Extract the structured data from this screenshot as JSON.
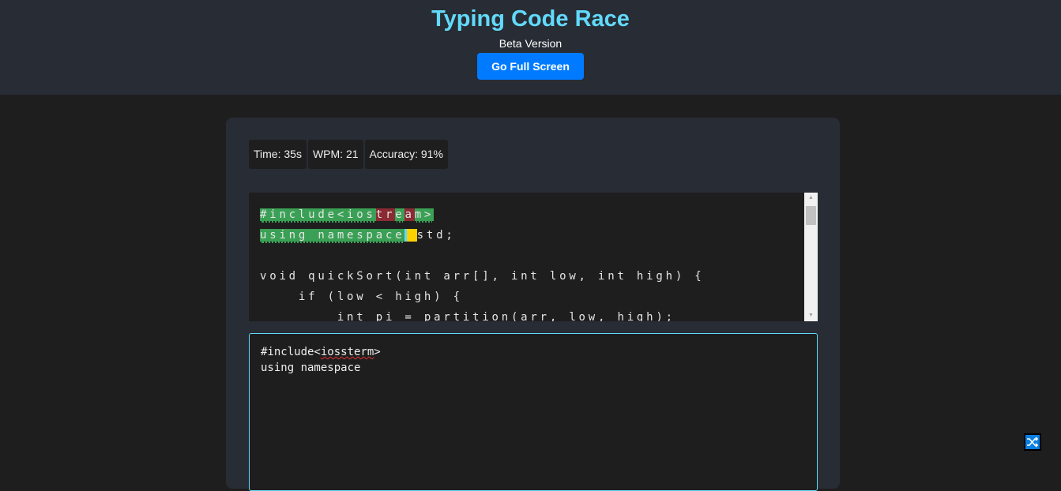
{
  "header": {
    "title": "Typing Code Race",
    "subtitle": "Beta Version",
    "fullscreen_label": "Go Full Screen"
  },
  "stats": {
    "time": "Time: 35s",
    "wpm": "WPM: 21",
    "accuracy": "Accuracy: 91%"
  },
  "code_lines": [
    [
      [
        "#include<ios",
        "correct"
      ],
      [
        "tr",
        "wrong"
      ],
      [
        "e",
        "correct"
      ],
      [
        "a",
        "wrong"
      ],
      [
        "m>",
        "correct"
      ]
    ],
    [
      [
        "using namespace",
        "correct"
      ],
      [
        " ",
        "current"
      ],
      [
        "std;",
        "pending"
      ]
    ],
    [
      [
        "",
        "pending"
      ]
    ],
    [
      [
        "void quickSort(int arr[], int low, int high) {",
        "pending"
      ]
    ],
    [
      [
        "    if (low < high) {",
        "pending"
      ]
    ],
    [
      [
        "        int pi = partition(arr, low, high);",
        "pending"
      ]
    ]
  ],
  "input": {
    "line1_pre": "#include<",
    "line1_misspelled": "iossterm",
    "line1_post": ">",
    "line2": "using namespace"
  },
  "colors": {
    "correct": "#3aa055",
    "wrong": "#8b2a33",
    "current": "#ffd000",
    "accent": "#61dafb",
    "button": "#007bff"
  },
  "icons": {
    "shuffle": "shuffle-icon"
  }
}
